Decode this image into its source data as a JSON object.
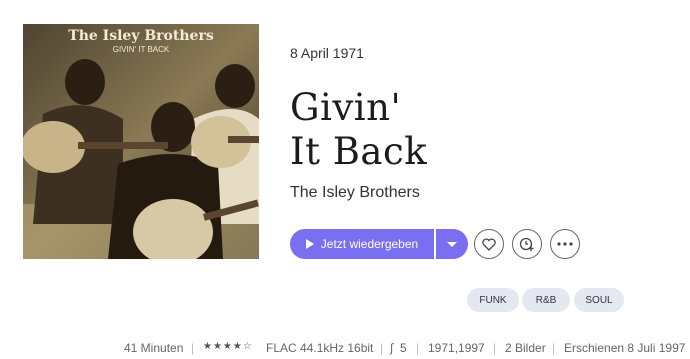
{
  "album": {
    "cover_alt": "The Isley Brothers - Givin' It Back cover",
    "cover_title_line1": "The Isley Brothers",
    "cover_title_line2": "GIVIN' IT BACK",
    "date": "8 April 1971",
    "title_line1": "Givin'",
    "title_line2": "It Back",
    "artist": "The Isley Brothers"
  },
  "actions": {
    "play_label": "Jetzt wiedergeben",
    "play_dropdown_icon": "chevron-down-icon",
    "favorite_icon": "heart-icon",
    "add_icon": "clock-plus-icon",
    "more_icon": "more-dots-icon"
  },
  "tags": [
    "FUNK",
    "R&B",
    "SOUL"
  ],
  "meta": {
    "duration": "41 Minuten",
    "rating_stars": "★★★★☆",
    "format": "FLAC 44.1kHz 16bit",
    "dynamic_range_icon": "waveform-icon",
    "dynamic_range": "5",
    "years": "1971,1997",
    "images": "2 Bilder",
    "released": "Erschienen 8 Juli 1997"
  },
  "colors": {
    "accent": "#7a6ff0",
    "tag_bg": "#e3e8f1"
  }
}
